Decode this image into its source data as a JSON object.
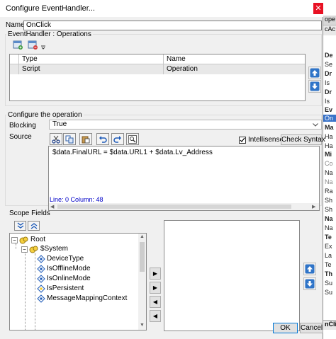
{
  "window": {
    "title": "Configure EventHandler...",
    "close_glyph": "✕"
  },
  "name_field": {
    "label": "Name",
    "value": "OnClick"
  },
  "operations": {
    "group_title": "EventHandler : Operations",
    "columns": [
      "Type",
      "Name"
    ],
    "rows": [
      {
        "type": "Script",
        "name": "Operation"
      }
    ]
  },
  "configure": {
    "group_title": "Configure the operation",
    "blocking_label": "Blocking",
    "blocking_value": "True",
    "source_label": "Source",
    "intellisense_label": "Intellisense",
    "intellisense_checked": true,
    "check_syntax_label": "Check Syntax",
    "source_code": "$data.FinalURL = $data.URL1 + $data.Lv_Address",
    "position_status": "Line: 0 Column:  48",
    "accent_color": "#0000c8"
  },
  "scope": {
    "label": "Scope Fields",
    "tree": [
      {
        "label": "Root",
        "level": 0,
        "expanded": true
      },
      {
        "label": "$System",
        "level": 1,
        "expanded": true
      },
      {
        "label": "DeviceType",
        "level": 2
      },
      {
        "label": "IsOfflineMode",
        "level": 2
      },
      {
        "label": "IsOnlineMode",
        "level": 2
      },
      {
        "label": "IsPersistent",
        "level": 2
      },
      {
        "label": "MessageMappingContext",
        "level": 2
      }
    ]
  },
  "buttons": {
    "ok": "OK",
    "cancel": "Cancel"
  },
  "background_panel": {
    "header": "ope",
    "subheader": "cAc",
    "rows": [
      "De",
      "Se",
      "Dr",
      "Is",
      "Dr",
      "Is",
      "Ev",
      "On",
      "Ma",
      "Ha",
      "Ha",
      "Mi",
      "Co",
      "Na",
      "Na",
      "Ra",
      "Sh",
      "Sh",
      "Na",
      "Na",
      "Te",
      "Ex",
      "La",
      "Te",
      "Th",
      "Su",
      "Su"
    ],
    "footer": "nCli"
  }
}
